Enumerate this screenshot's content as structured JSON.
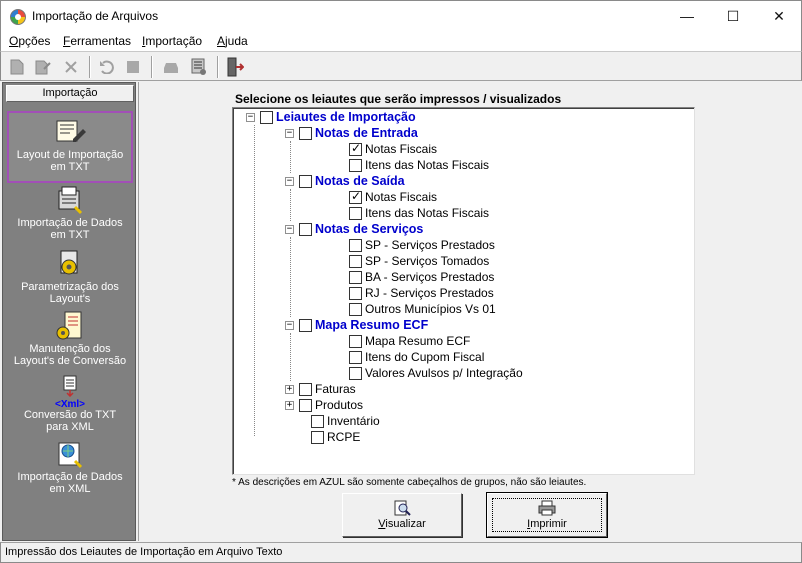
{
  "window": {
    "title": "Importação de Arquivos",
    "controls": {
      "minimize": "—",
      "maximize": "☐",
      "close": "✕"
    }
  },
  "menubar": {
    "items": [
      {
        "underline": "O",
        "rest": "pções"
      },
      {
        "underline": "F",
        "rest": "erramentas"
      },
      {
        "underline": "I",
        "rest": "mportação"
      },
      {
        "underline": "A",
        "rest": "juda"
      }
    ]
  },
  "toolbar": {
    "icons": [
      "new-icon",
      "edit-icon",
      "delete-icon",
      "undo-icon",
      "stop-icon",
      "print-icon",
      "config-icon",
      "exit-icon"
    ]
  },
  "sidebar": {
    "header": "Importação",
    "items": [
      {
        "label_line1": "Layout de Importação",
        "label_line2": "em TXT",
        "icon": "layout-txt-icon",
        "selected": true
      },
      {
        "label_line1": "Importação de Dados",
        "label_line2": "em TXT",
        "icon": "import-txt-icon",
        "selected": false
      },
      {
        "label_line1": "Parametrização dos",
        "label_line2": "Layout's",
        "icon": "parameters-icon",
        "selected": false
      },
      {
        "label_line1": "Manutenção dos",
        "label_line2": "Layout's de Conversão",
        "icon": "maintenance-icon",
        "selected": false
      },
      {
        "label_line1": "Conversão do TXT",
        "label_line2": "para XML",
        "icon": "xml-convert-icon",
        "icon_text": "<Xml>",
        "selected": false
      },
      {
        "label_line1": "Importação de Dados",
        "label_line2": "em XML",
        "icon": "import-xml-icon",
        "selected": false
      }
    ]
  },
  "main": {
    "instruction": "Selecione os leiautes que serão impressos / visualizados",
    "tree": [
      {
        "label": "Leiautes de Importação",
        "group": true,
        "checked": false,
        "expander": "−"
      },
      {
        "label": "Notas de Entrada",
        "group": true,
        "checked": false,
        "expander": "−"
      },
      {
        "label": "Notas Fiscais",
        "group": false,
        "checked": true
      },
      {
        "label": "Itens das Notas Fiscais",
        "group": false,
        "checked": false
      },
      {
        "label": "Notas de Saída",
        "group": true,
        "checked": false,
        "expander": "−"
      },
      {
        "label": "Notas Fiscais",
        "group": false,
        "checked": true
      },
      {
        "label": "Itens das Notas Fiscais",
        "group": false,
        "checked": false
      },
      {
        "label": "Notas de Serviços",
        "group": true,
        "checked": false,
        "expander": "−"
      },
      {
        "label": "SP - Serviços Prestados",
        "group": false,
        "checked": false
      },
      {
        "label": "SP - Serviços Tomados",
        "group": false,
        "checked": false
      },
      {
        "label": "BA - Serviços Prestados",
        "group": false,
        "checked": false
      },
      {
        "label": "RJ - Serviços Prestados",
        "group": false,
        "checked": false
      },
      {
        "label": "Outros Municípios Vs 01",
        "group": false,
        "checked": false
      },
      {
        "label": "Mapa Resumo ECF",
        "group": true,
        "checked": false,
        "expander": "−"
      },
      {
        "label": "Mapa Resumo ECF",
        "group": false,
        "checked": false
      },
      {
        "label": "Itens do Cupom Fiscal",
        "group": false,
        "checked": false
      },
      {
        "label": "Valores Avulsos p/ Integração",
        "group": false,
        "checked": false
      },
      {
        "label": "Faturas",
        "group": false,
        "checked": false,
        "expander": "+"
      },
      {
        "label": "Produtos",
        "group": false,
        "checked": false,
        "expander": "+"
      },
      {
        "label": "Inventário",
        "group": false,
        "checked": false
      },
      {
        "label": "RCPE",
        "group": false,
        "checked": false
      }
    ],
    "note": "* As descrições em AZUL são somente cabeçalhos de grupos, não são leiautes.",
    "buttons": {
      "visualizar": {
        "underline": "V",
        "rest": "isualizar"
      },
      "imprimir": {
        "underline": "I",
        "rest": "mprimir"
      }
    }
  },
  "statusbar": {
    "text": "Impressão dos Leiautes de Importação em Arquivo Texto"
  },
  "colors": {
    "group_header": "#0000cc",
    "sidebar_bg": "#808080",
    "selection_border": "#a24fb7"
  }
}
